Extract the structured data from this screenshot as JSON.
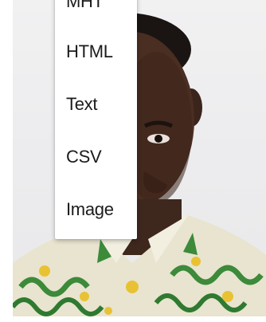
{
  "export_menu": {
    "items": [
      {
        "label": "MHT"
      },
      {
        "label": "HTML"
      },
      {
        "label": "Text"
      },
      {
        "label": "CSV"
      },
      {
        "label": "Image"
      }
    ]
  },
  "colors": {
    "menu_background": "#ffffff",
    "menu_text": "#1b1b1b",
    "photo_background": "#ececee"
  }
}
